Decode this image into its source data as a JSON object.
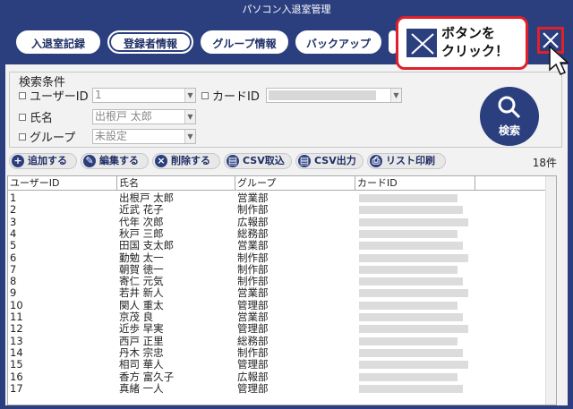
{
  "window": {
    "title": "パソコン入退室管理"
  },
  "nav": {
    "tabs": [
      "入退室記録",
      "登録者情報",
      "グループ情報",
      "バックアップ"
    ],
    "active_index": 1
  },
  "search": {
    "legend": "検索条件",
    "user_id_label": "ユーザーID",
    "user_id_value": "1",
    "card_id_label": "カードID",
    "name_label": "氏名",
    "name_value": "出根戸 太郎",
    "group_label": "グループ",
    "group_value": "未設定",
    "button_label": "検索"
  },
  "toolbar": {
    "add": "追加する",
    "edit": "編集する",
    "delete": "削除する",
    "csv_import": "CSV取込",
    "csv_export": "CSV出力",
    "print": "リスト印刷",
    "count": "18件"
  },
  "table": {
    "columns": [
      "ユーザーID",
      "氏名",
      "グループ",
      "カードID"
    ],
    "rows": [
      [
        "1",
        "出根戸 太郎",
        "営業部"
      ],
      [
        "2",
        "近武 花子",
        "制作部"
      ],
      [
        "3",
        "代年 次郎",
        "広報部"
      ],
      [
        "4",
        "秋戸 三郎",
        "総務部"
      ],
      [
        "5",
        "田国 支太郎",
        "営業部"
      ],
      [
        "6",
        "勤勉 太一",
        "制作部"
      ],
      [
        "7",
        "朝賀 徳一",
        "制作部"
      ],
      [
        "8",
        "寄仁 元気",
        "制作部"
      ],
      [
        "9",
        "若井 新人",
        "営業部"
      ],
      [
        "10",
        "関人 重太",
        "管理部"
      ],
      [
        "11",
        "京茂 良",
        "営業部"
      ],
      [
        "12",
        "近歩 早実",
        "管理部"
      ],
      [
        "13",
        "西戸 正里",
        "総務部"
      ],
      [
        "14",
        "丹木 宗忠",
        "制作部"
      ],
      [
        "15",
        "相司 華人",
        "管理部"
      ],
      [
        "16",
        "香方 富久子",
        "広報部"
      ],
      [
        "17",
        "真緒 一人",
        "管理部"
      ]
    ]
  },
  "callout": {
    "line1": "ボタンを",
    "line2": "クリック！"
  },
  "colors": {
    "brand": "#2b3f7f",
    "highlight": "#e0202a"
  }
}
